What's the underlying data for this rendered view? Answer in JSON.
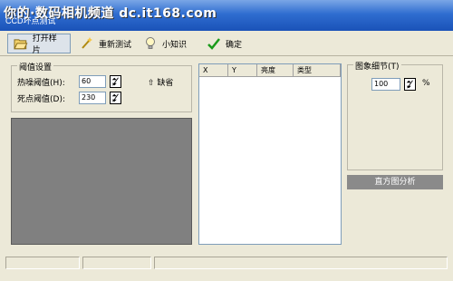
{
  "window": {
    "title": "CCD坏点测试",
    "watermark": "你的·数码相机频道 dc.it168.com"
  },
  "toolbar": {
    "open_sample": "打开样片",
    "retest": "重新测试",
    "tips": "小知识",
    "ok": "确定"
  },
  "threshold": {
    "group_label": "阈值设置",
    "hot_label": "热噪阈值(H):",
    "hot_value": "60",
    "dead_label": "死点阈值(D):",
    "dead_value": "230",
    "default_label": "缺省"
  },
  "table": {
    "columns": [
      "X",
      "Y",
      "亮度",
      "类型"
    ]
  },
  "detail": {
    "group_label": "图象细节(T)",
    "value": "100",
    "unit": "%"
  },
  "histogram_button": "直方图分析"
}
